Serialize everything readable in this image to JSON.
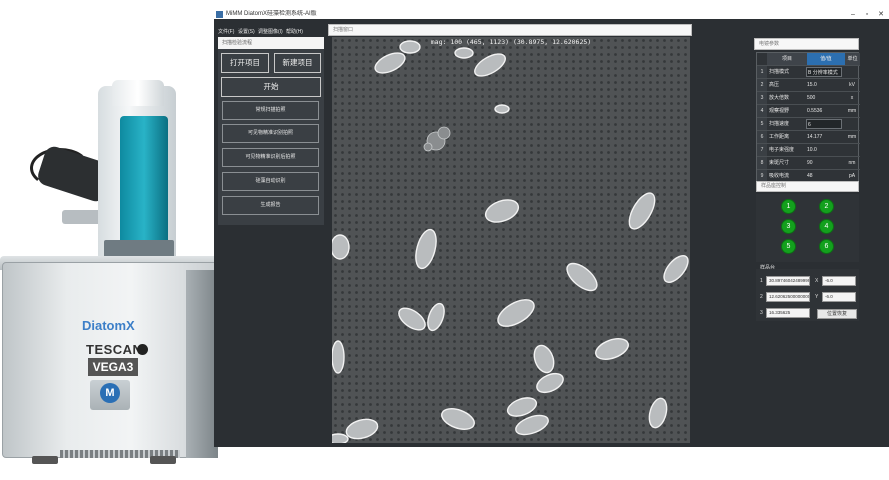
{
  "instrument": {
    "brand": "DiatomX",
    "manufacturer": "TESCAN",
    "model": "VEGA3",
    "logo_letter": "M"
  },
  "window": {
    "title": "MiMM DiatomX硅藻检测系统-AI版",
    "minimize": "–",
    "maximize": "▫",
    "close": "✕"
  },
  "menu": [
    "文件(F)",
    "设置(S)",
    "调整图像(I)",
    "帮助(H)"
  ],
  "left_panel": {
    "header": "扫描检验流程",
    "open_project": "打开项目",
    "new_project": "新建项目",
    "start": "开始",
    "steps": [
      "常规扫描拍照",
      "可见物精准识别拍照",
      "可见物精准识别后拍照",
      "硅藻自动识别",
      "生成报告"
    ]
  },
  "image_panel": {
    "title": "扫描窗口",
    "overlay": "mag: 100 (465, 1123) (30.8975, 12.620625)"
  },
  "params": {
    "title": "电镜参数",
    "headers": [
      "项目",
      "值/值",
      "单位"
    ],
    "rows": [
      {
        "idx": "1",
        "name": "扫描模式",
        "value": "B 分辨率模式",
        "unit": "",
        "dropdown": true
      },
      {
        "idx": "2",
        "name": "高压",
        "value": "15.0",
        "unit": "kV",
        "dropdown": false
      },
      {
        "idx": "3",
        "name": "放大倍数",
        "value": "500",
        "unit": "x",
        "dropdown": false
      },
      {
        "idx": "4",
        "name": "观察视野",
        "value": "0.5536",
        "unit": "mm",
        "dropdown": false
      },
      {
        "idx": "5",
        "name": "扫描速度",
        "value": "6",
        "unit": "",
        "dropdown": true
      },
      {
        "idx": "6",
        "name": "工作距离",
        "value": "14.177",
        "unit": "mm",
        "dropdown": false
      },
      {
        "idx": "7",
        "name": "电子束强度",
        "value": "10.0",
        "unit": "",
        "dropdown": false
      },
      {
        "idx": "8",
        "name": "束斑尺寸",
        "value": "90",
        "unit": "nm",
        "dropdown": false
      },
      {
        "idx": "9",
        "name": "吸收电流",
        "value": "48",
        "unit": "pA",
        "dropdown": false
      }
    ]
  },
  "holder": {
    "title": "样品座控制",
    "positions": [
      "1",
      "2",
      "3",
      "4",
      "5",
      "6"
    ]
  },
  "position": {
    "label": "样品台",
    "rows": [
      {
        "idx": "1",
        "value": "30.8974604248999996",
        "axis": "X",
        "step": "-6.0"
      },
      {
        "idx": "2",
        "value": "12.62062500000000001",
        "axis": "Y",
        "step": "-6.0"
      },
      {
        "idx": "3",
        "value": "16.335625",
        "axis": "",
        "step": ""
      }
    ],
    "button": "位置恢复"
  },
  "colors": {
    "app_bg": "#2b2f33",
    "panel_bg": "#3a3f44",
    "holder_green": "#13a01d",
    "sem_gray": "#4b4e50",
    "brand_blue": "#3c7fc8",
    "teal": "#29b3c7"
  }
}
